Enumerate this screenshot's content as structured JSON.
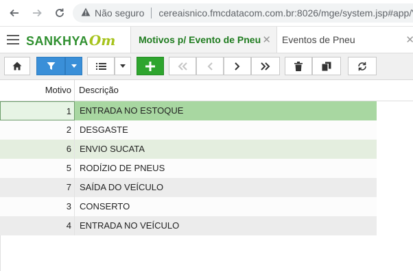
{
  "browser": {
    "security_text": "Não seguro",
    "url": "cereaisnico.fmcdatacom.com.br:8026/mge/system.jsp#app/V"
  },
  "app": {
    "logo_main": "SANKHYA",
    "logo_suffix": "Om",
    "tabs": [
      {
        "label": "Motivos p/ Evento de Pneu",
        "active": true
      },
      {
        "label": "Eventos de Pneu",
        "active": false
      }
    ]
  },
  "grid": {
    "columns": [
      "Motivo",
      "Descrição"
    ],
    "rows": [
      {
        "motivo": "1",
        "descricao": "ENTRADA NO ESTOQUE"
      },
      {
        "motivo": "2",
        "descricao": "DESGASTE"
      },
      {
        "motivo": "6",
        "descricao": "ENVIO SUCATA"
      },
      {
        "motivo": "5",
        "descricao": "RODÍZIO DE PNEUS"
      },
      {
        "motivo": "7",
        "descricao": "SAÍDA DO VEÍCULO"
      },
      {
        "motivo": "3",
        "descricao": "CONSERTO"
      },
      {
        "motivo": "4",
        "descricao": "ENTRADA NO VEÍCULO"
      }
    ]
  },
  "icons": {
    "back": "arrow-left-icon",
    "forward": "arrow-right-icon",
    "reload": "reload-icon",
    "warning": "warning-icon",
    "menu": "hamburger-icon",
    "home": "home-icon",
    "filter": "filter-icon",
    "list": "list-icon",
    "add": "plus-icon",
    "first": "double-chevron-left-icon",
    "prev": "chevron-left-icon",
    "next": "chevron-right-icon",
    "last": "double-chevron-right-icon",
    "delete": "trash-icon",
    "copy": "copy-icon",
    "refresh": "refresh-icon"
  },
  "colors": {
    "brand_green": "#2f8f2f",
    "brand_lime": "#a6c31c",
    "selected_row": "#a8d7a1",
    "filter_blue": "#3a8fd8",
    "add_green": "#2ea52e"
  }
}
